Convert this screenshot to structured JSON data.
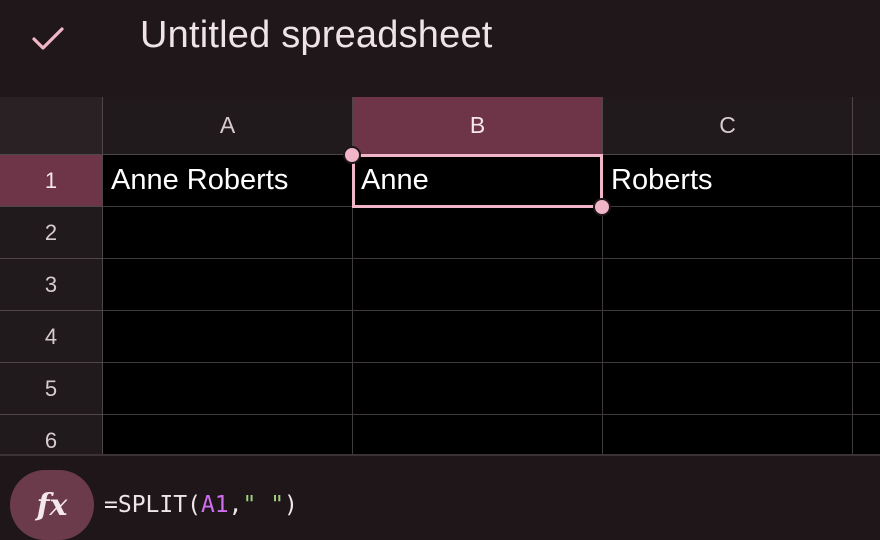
{
  "app": {
    "title": "Untitled spreadsheet",
    "done_icon": "checkmark-icon",
    "accent_color": "#f0b6c8",
    "header_selected_color": "#6e3549"
  },
  "columns": [
    {
      "label": "A",
      "selected": false
    },
    {
      "label": "B",
      "selected": true
    },
    {
      "label": "C",
      "selected": false
    }
  ],
  "rows": [
    {
      "label": "1",
      "selected": true,
      "cells": [
        "Anne Roberts",
        "Anne",
        "Roberts"
      ]
    },
    {
      "label": "2",
      "selected": false,
      "cells": [
        "",
        "",
        ""
      ]
    },
    {
      "label": "3",
      "selected": false,
      "cells": [
        "",
        "",
        ""
      ]
    },
    {
      "label": "4",
      "selected": false,
      "cells": [
        "",
        "",
        ""
      ]
    },
    {
      "label": "5",
      "selected": false,
      "cells": [
        "",
        "",
        ""
      ]
    },
    {
      "label": "6",
      "selected": false,
      "cells": [
        "",
        "",
        ""
      ]
    }
  ],
  "active_cell": "B1",
  "formula_bar": {
    "fx_label": "fx",
    "fx_icon": "function-icon",
    "prefix": "=SPLIT(",
    "ref": "A1",
    "comma": ",",
    "string_arg": "\" \"",
    "suffix": ")"
  }
}
